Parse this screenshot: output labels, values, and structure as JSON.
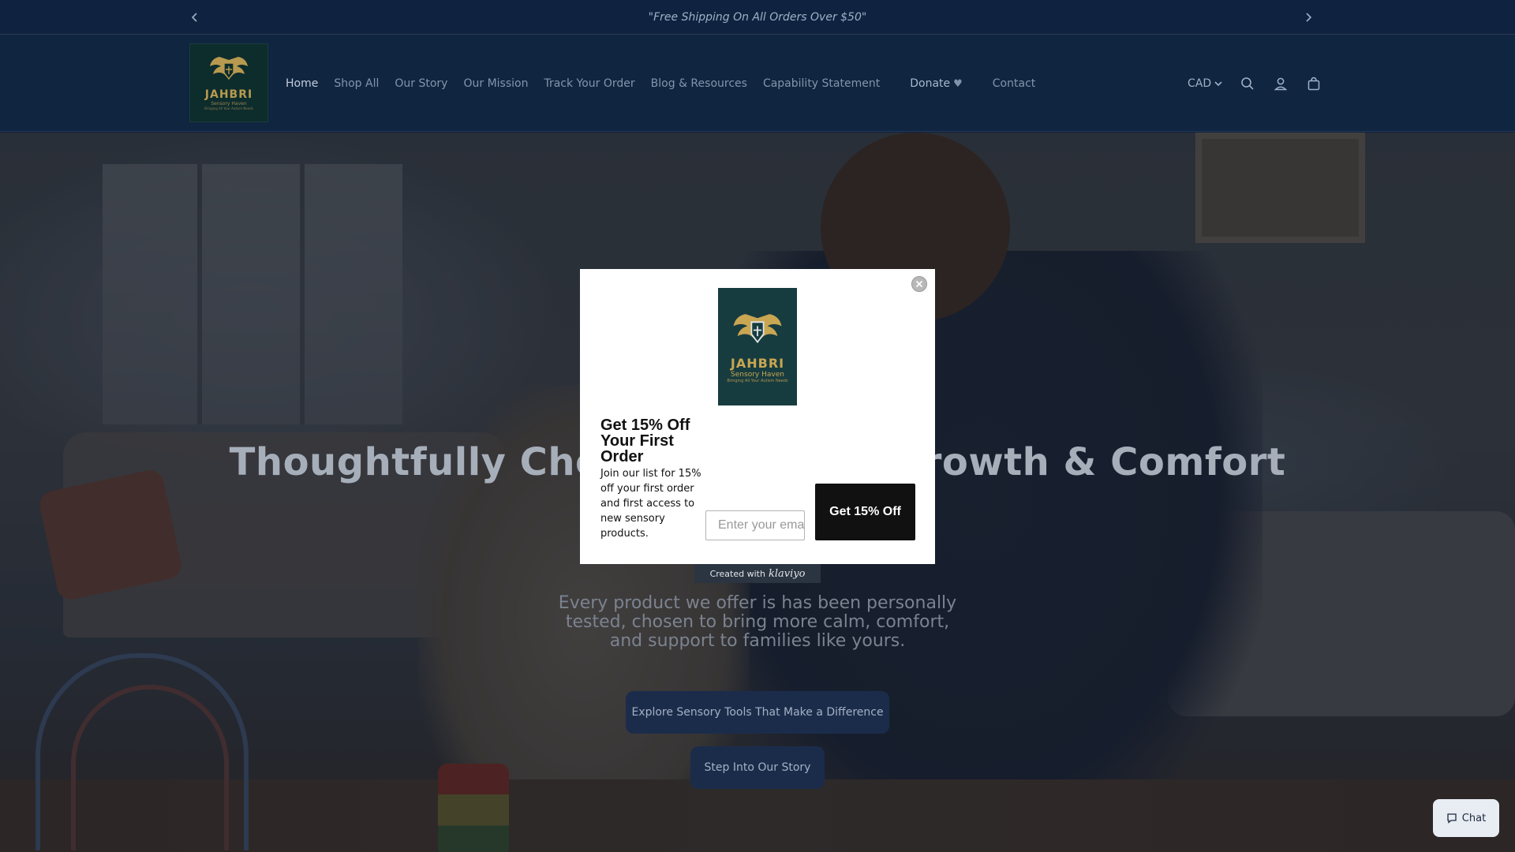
{
  "announcement": {
    "text": "\"Free Shipping On All Orders Over $50\"",
    "prev_icon": "chevron-left-icon",
    "next_icon": "chevron-right-icon"
  },
  "brand": {
    "name": "JAHBRI",
    "sub": "Sensory Haven",
    "tagline": "Bringing All Your Autism Needs",
    "colors": {
      "gold": "#c9a652",
      "teal": "#173c3f",
      "navy": "#102540"
    }
  },
  "nav": {
    "items": [
      {
        "label": "Home",
        "active": true
      },
      {
        "label": "Shop All"
      },
      {
        "label": "Our Story"
      },
      {
        "label": "Our Mission"
      },
      {
        "label": "Track Your Order"
      },
      {
        "label": "Blog & Resources"
      },
      {
        "label": "Capability Statement"
      },
      {
        "label": "Donate",
        "icon": "heart-icon"
      },
      {
        "label": "Contact"
      }
    ]
  },
  "header_right": {
    "currency": "CAD",
    "icons": [
      "search-icon",
      "account-icon",
      "cart-icon"
    ]
  },
  "hero": {
    "title": "Thoughtfully Chosen Tools for Growth & Comfort",
    "subtitle": "Every product we offer is has been personally tested, chosen to bring more calm, comfort, and support to families like yours.",
    "primary_button": "Explore Sensory Tools That Make a Difference",
    "secondary_button": "Step Into Our Story"
  },
  "popup": {
    "heading": "Get 15% Off Your First Order",
    "body": "Join our list for 15% off your first order and first access to new sensory products.",
    "email_placeholder": "Enter your email",
    "cta": "Get 15% Off",
    "close_icon": "close-icon",
    "footer_text": "Created with",
    "footer_brand": "klaviyo"
  },
  "chat": {
    "label": "Chat",
    "icon": "chat-icon"
  }
}
